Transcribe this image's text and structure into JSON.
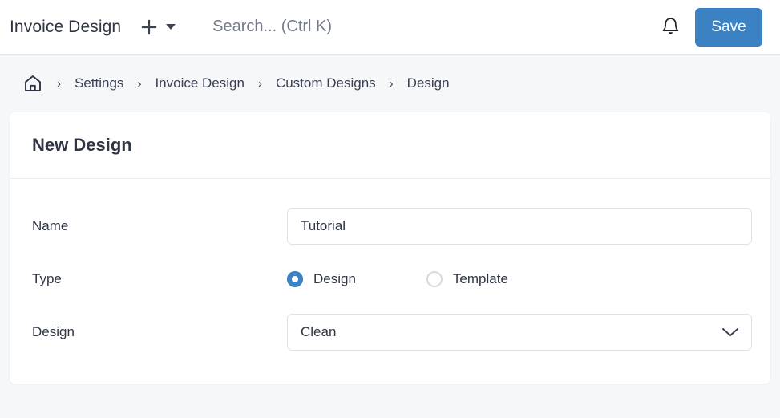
{
  "header": {
    "app_title": "Invoice Design",
    "add_icon": "plus-icon",
    "add_caret_icon": "caret-down-icon",
    "search_placeholder": "Search... (Ctrl K)",
    "search_value": "",
    "notifications_icon": "bell-icon",
    "save_label": "Save",
    "accent_color": "#3b82c4"
  },
  "breadcrumb": {
    "home_icon": "home-icon",
    "separator": "›",
    "items": [
      {
        "label": "Settings"
      },
      {
        "label": "Invoice Design"
      },
      {
        "label": "Custom Designs"
      },
      {
        "label": "Design"
      }
    ]
  },
  "card": {
    "title": "New Design",
    "fields": {
      "name": {
        "label": "Name",
        "value": "Tutorial",
        "placeholder": ""
      },
      "type": {
        "label": "Type",
        "selected": "Design",
        "options": [
          {
            "label": "Design",
            "selected": true
          },
          {
            "label": "Template",
            "selected": false
          }
        ]
      },
      "design": {
        "label": "Design",
        "value": "Clean",
        "chevron_icon": "chevron-down-icon"
      }
    }
  }
}
